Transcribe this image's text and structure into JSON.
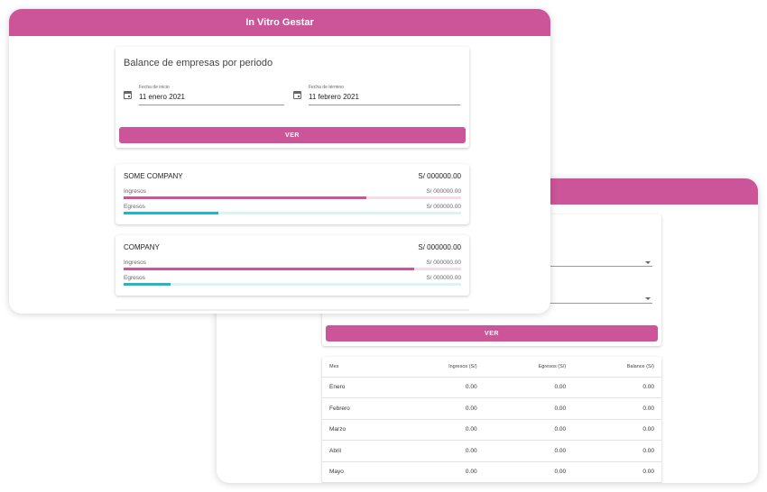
{
  "colors": {
    "accent": "#cc5498",
    "accent_light": "#f6dce9",
    "teal": "#20b6c2",
    "teal_light": "#dcf3f5"
  },
  "app": {
    "title": "In Vitro Gestar"
  },
  "balance_form": {
    "title": "Balance de empresas por periodo",
    "start": {
      "label": "Fecha de inicio",
      "value": "11 enero 2021",
      "icon": "calendar-icon"
    },
    "end": {
      "label": "Fecha de término",
      "value": "11 febrero 2021",
      "icon": "calendar-icon"
    },
    "button": "VER"
  },
  "companies": [
    {
      "name": "SOME COMPANY",
      "total": "S/ 000000.00",
      "ingresos": {
        "label": "Ingresos",
        "value": "S/ 000000.00",
        "progress": 0.72
      },
      "egresos": {
        "label": "Egresos",
        "value": "S/ 000000.00",
        "progress": 0.28
      }
    },
    {
      "name": "COMPANY",
      "total": "S/ 000000.00",
      "ingresos": {
        "label": "Ingresos",
        "value": "S/ 000000.00",
        "progress": 0.86
      },
      "egresos": {
        "label": "Egresos",
        "value": "S/ 000000.00",
        "progress": 0.14
      }
    }
  ],
  "monthly": {
    "button": "VER",
    "columns": [
      "Mes",
      "Ingresos (S/)",
      "Egresos (S/)",
      "Balance (S/)"
    ],
    "rows": [
      [
        "Enero",
        "0.00",
        "0.00",
        "0.00"
      ],
      [
        "Febrero",
        "0.00",
        "0.00",
        "0.00"
      ],
      [
        "Marzo",
        "0.00",
        "0.00",
        "0.00"
      ],
      [
        "Abril",
        "0.00",
        "0.00",
        "0.00"
      ],
      [
        "Mayo",
        "0.00",
        "0.00",
        "0.00"
      ]
    ]
  }
}
